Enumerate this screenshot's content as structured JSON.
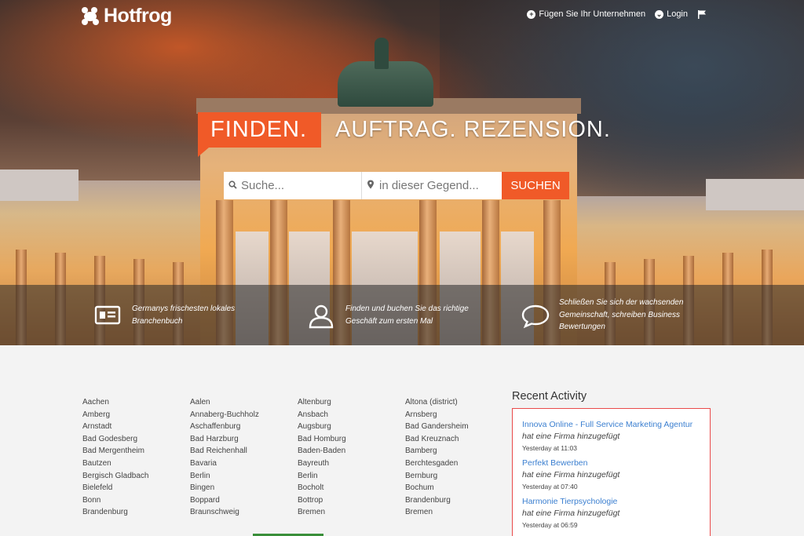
{
  "header": {
    "logo_text": "Hotfrog",
    "nav": {
      "add_business": "Fügen Sie Ihr Unternehmen",
      "login": "Login"
    }
  },
  "hero": {
    "tagline_highlight": "FINDEN.",
    "tagline_rest": "AUFTRAG. REZENSION."
  },
  "search": {
    "what_placeholder": "Suche...",
    "where_placeholder": "in dieser Gegend...",
    "button_label": "SUCHEN"
  },
  "features": [
    {
      "icon": "id-card-icon",
      "text": "Germanys frischesten lokales Branchenbuch"
    },
    {
      "icon": "user-icon",
      "text": "Finden und buchen Sie das richtige Geschäft zum ersten Mal"
    },
    {
      "icon": "speech-bubble-icon",
      "text": "Schließen Sie sich der wachsenden Gemeinschaft, schreiben Business Bewertungen"
    }
  ],
  "cities": [
    [
      "Aachen",
      "Amberg",
      "Arnstadt",
      "Bad Godesberg",
      "Bad Mergentheim",
      "Bautzen",
      "Bergisch Gladbach",
      "Bielefeld",
      "Bonn",
      "Brandenburg"
    ],
    [
      "Aalen",
      "Annaberg-Buchholz",
      "Aschaffenburg",
      "Bad Harzburg",
      "Bad Reichenhall",
      "Bavaria",
      "Berlin",
      "Bingen",
      "Boppard",
      "Braunschweig"
    ],
    [
      "Altenburg",
      "Ansbach",
      "Augsburg",
      "Bad Homburg",
      "Baden-Baden",
      "Bayreuth",
      "Berlin",
      "Bocholt",
      "Bottrop",
      "Bremen"
    ],
    [
      "Altona (district)",
      "Arnsberg",
      "Bad Gandersheim",
      "Bad Kreuznach",
      "Bamberg",
      "Berchtesgaden",
      "Bernburg",
      "Bochum",
      "Brandenburg",
      "Bremen"
    ]
  ],
  "recent_activity": {
    "title": "Recent Activity",
    "items": [
      {
        "name": "Innova Online - Full Service Marketing Agentur",
        "desc": "hat eine Firma hinzugefügt",
        "time": "Yesterday at 11:03"
      },
      {
        "name": "Perfekt Bewerben",
        "desc": "hat eine Firma hinzugefügt",
        "time": "Yesterday at 07:40"
      },
      {
        "name": "Harmonie Tierpsychologie",
        "desc": "hat eine Firma hinzugefügt",
        "time": "Yesterday at 06:59"
      }
    ]
  },
  "colors": {
    "accent": "#f05a28",
    "link": "#3b7fd0",
    "activity_border": "#e94a4a"
  }
}
